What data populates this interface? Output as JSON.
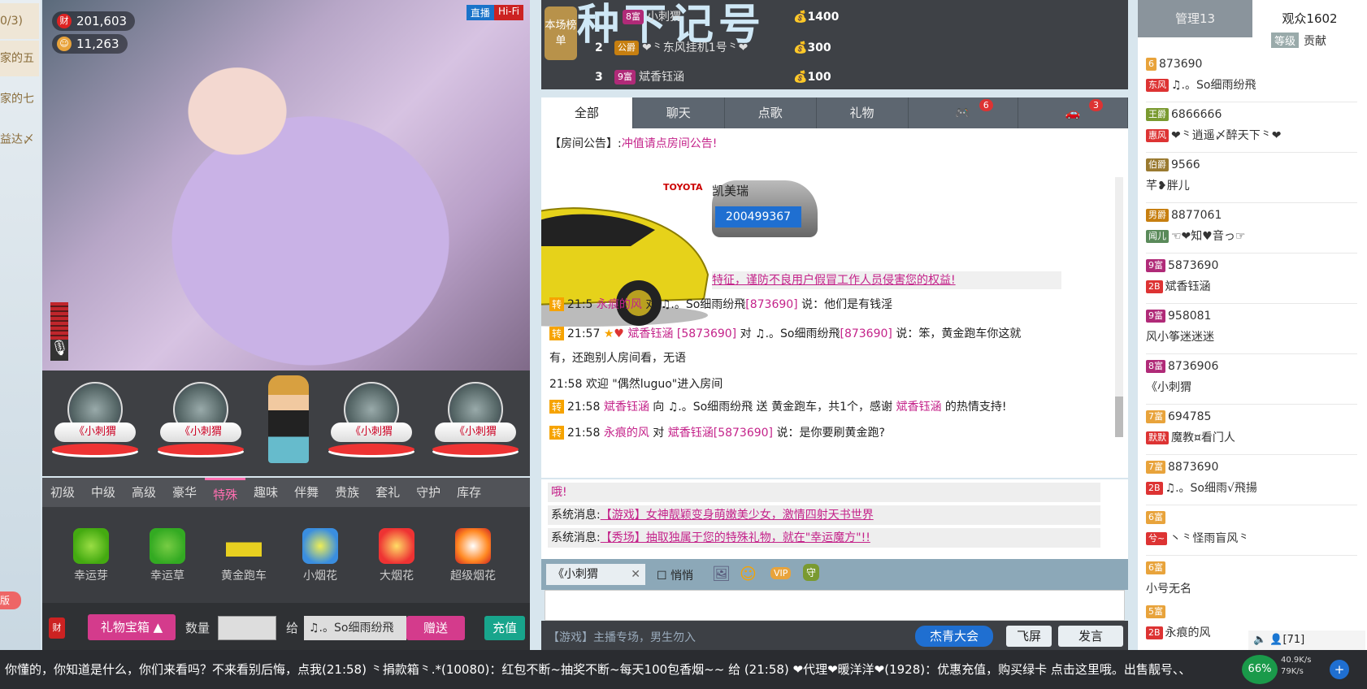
{
  "left_strip": {
    "items": [
      "0/3)",
      "家的五",
      "家的七",
      "益达〆"
    ],
    "version_tag": "版"
  },
  "video": {
    "wealth": "201,603",
    "fans": "11,263",
    "tag_live": "直播",
    "tag_hifi": "Hi-Fi",
    "wealth_icon": "财"
  },
  "gift_stage": {
    "seats": [
      "《小刺猬",
      "《小刺猬",
      "《小刺猬",
      "《小刺猬"
    ]
  },
  "gift_tabs": [
    "初级",
    "中级",
    "高级",
    "豪华",
    "特殊",
    "趣味",
    "伴舞",
    "贵族",
    "套礼",
    "守护",
    "库存"
  ],
  "gifts": [
    "幸运芽",
    "幸运草",
    "黄金跑车",
    "小烟花",
    "大烟花",
    "超级烟花"
  ],
  "send_bar": {
    "gift_box": "礼物宝箱",
    "qty_label": "数量",
    "to_label": "给",
    "target": "♫.。So细雨纷飛",
    "send": "赠送",
    "recharge": "充值"
  },
  "rank": {
    "board_label": "本场榜单",
    "headline": "种下记号",
    "rows": [
      {
        "no": "",
        "lvl": "8富",
        "name": "小刺猬",
        "gold": "1400"
      },
      {
        "no": "2",
        "lvl": "公爵",
        "name": "❤⺀东风挂机1号⺀❤",
        "gold": "300"
      },
      {
        "no": "3",
        "lvl": "9富",
        "name": "斌香钰涵",
        "gold": "100"
      }
    ]
  },
  "chat_tabs": [
    {
      "label": "全部"
    },
    {
      "label": "聊天"
    },
    {
      "label": "点歌"
    },
    {
      "label": "礼物"
    },
    {
      "label": "",
      "count": "6"
    },
    {
      "label": "",
      "count": "3"
    }
  ],
  "chat": {
    "announce_prefix": "【房间公告】:",
    "announce": "冲值请点房间公告!",
    "car_brand": "TOYOTA",
    "car_name": "凯美瑞",
    "car_user_id": "200499367",
    "warning": "特征，谨防不良用户假冒工作人员侵害您的权益!",
    "l1": {
      "t": "21:5",
      "u": "永痕的风",
      "mid": "对 ♫.。So细雨纷飛",
      "id": "[873690]",
      "text": "说：他们是有钱淫"
    },
    "l2": {
      "t": "21:57",
      "u": "斌香钰涵",
      "id": "[5873690]",
      "mid": "对 ♫.。So细雨纷飛",
      "id2": "[873690]",
      "text": "说：笨，黄金跑车你这就",
      "cont": "有，还跑别人房间看，无语"
    },
    "l3": {
      "t": "21:58",
      "text": "欢迎 \"偶然luguo\"进入房间"
    },
    "l4": {
      "t": "21:58",
      "u": "斌香钰涵",
      "mid": "向 ♫.。So细雨纷飛 送",
      "text": "黄金跑车，共1个，感谢",
      "u2": "斌香钰涵",
      "end": "的热情支持!"
    },
    "l5": {
      "t": "21:58",
      "u": "永痕的风",
      "mid": "对",
      "u2": "斌香钰涵",
      "id": "[5873690]",
      "text": "说：是你要刷黄金跑?"
    },
    "zhuan": "转"
  },
  "sys": {
    "m0": "哦!",
    "m1_prefix": "系统消息:",
    "m1": "【游戏】女神靓颖变身萌嫩美少女，激情四射天书世界",
    "m2_prefix": "系统消息:",
    "m2": "【秀场】抽取独属于您的特殊礼物，就在\"幸运魔方\"!!"
  },
  "input_bar": {
    "target": "《小刺猬",
    "quiet": "悄悄"
  },
  "bottom_ctrl": {
    "promo": "【游戏】主播专场，男生勿入",
    "event": "杰青大会",
    "fly": "飞屏",
    "send": "发言"
  },
  "user_list": {
    "tab_admin": "管理13",
    "tab_audience": "观众1602",
    "sort_level": "等级",
    "sort_contrib": "贡献",
    "users": [
      {
        "lvl": "6",
        "id": "873690",
        "name": "♫.。So细雨纷飛",
        "badge": "东风"
      },
      {
        "lvl": "王爵",
        "id": "6866666",
        "name": "❤⺀逍遥〆醉天下⺀❤",
        "badge": "惠风"
      },
      {
        "lvl": "伯爵",
        "id": "9566",
        "name": "芊❥胖儿",
        "badge": ""
      },
      {
        "lvl": "男爵",
        "id": "8877061",
        "name": "☜❤知♥音っ☞",
        "badge": "闻儿"
      },
      {
        "lvl": "9富",
        "id": "5873690",
        "name": "斌香钰涵",
        "badge": "2B"
      },
      {
        "lvl": "9富",
        "id": "958081",
        "name": "风小筝迷迷迷",
        "badge": ""
      },
      {
        "lvl": "8富",
        "id": "8736906",
        "name": "《小刺猬",
        "badge": ""
      },
      {
        "lvl": "7富",
        "id": "694785",
        "name": "魔教¤看门人",
        "badge": "默默"
      },
      {
        "lvl": "7富",
        "id": "8873690",
        "name": "♫.。So细雨√飛揚",
        "badge": "2B"
      },
      {
        "lvl": "6富",
        "id": "",
        "name": "丶⺀怪雨盲风⺀",
        "badge": "兮~"
      },
      {
        "lvl": "6富",
        "id": "",
        "name": "小号无名",
        "badge": ""
      },
      {
        "lvl": "5富",
        "id": "",
        "name": "永痕的风",
        "badge": "2B"
      }
    ],
    "online": "[71]",
    "percent": "66%",
    "net_up": "40.9K/s",
    "net_down": "79K/s"
  },
  "ticker": {
    "text": "你懂的，你知道是什么，你们来看吗？不来看别后悔，点我(21:58)  ⺀捐款箱⺀.*(10080)：红包不断~抽奖不断~每天100包香烟~~ 给 (21:58)  ❤代理❤暖洋洋❤(1928)：优惠充值，购买绿卡 点击这里哦。出售靓号、、"
  },
  "colors": {
    "pink": "#c4238a",
    "accent_blue": "#1f6fd1",
    "gold_icon": "#f6a300"
  }
}
